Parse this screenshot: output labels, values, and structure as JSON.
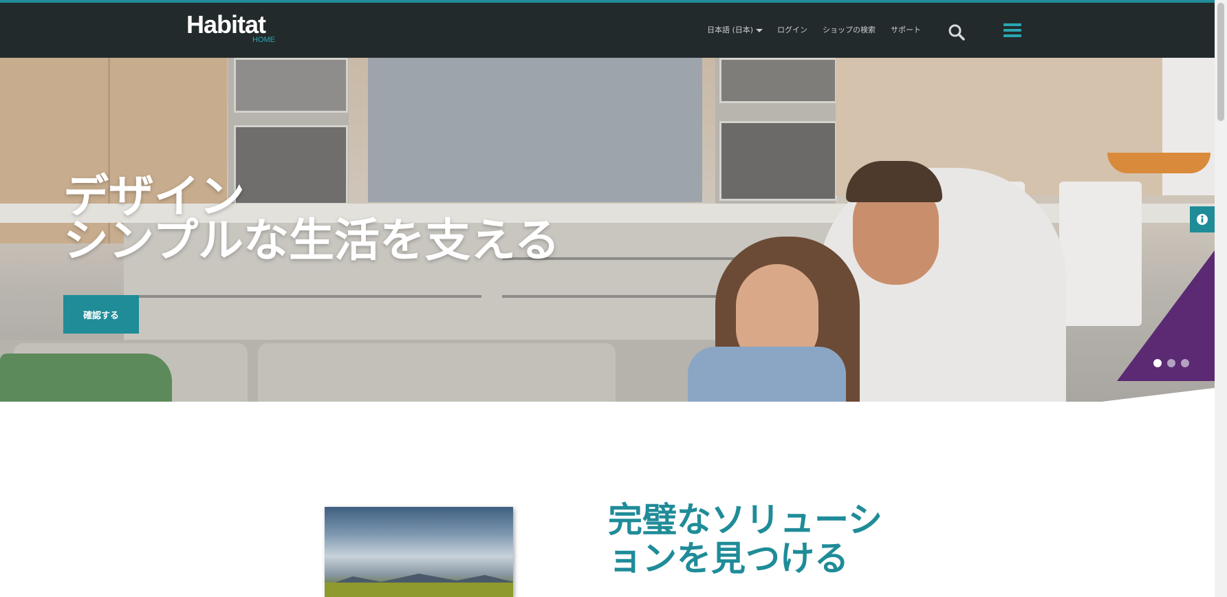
{
  "header": {
    "logo": {
      "main": "Habitat",
      "sub": "HOME"
    },
    "language_label": "日本語 (日本)",
    "nav": [
      {
        "id": "login",
        "label": "ログイン"
      },
      {
        "id": "store_locator",
        "label": "ショップの検索"
      },
      {
        "id": "support",
        "label": "サポート"
      }
    ],
    "icons": {
      "search": "search-icon",
      "menu": "menu-icon"
    }
  },
  "hero": {
    "title_line1": "デザイン",
    "title_line2": "シンプルな生活を支える",
    "cta_label": "確認する",
    "slides": {
      "count": 3,
      "active_index": 0
    },
    "info_icon": "info-icon"
  },
  "feature": {
    "title": "完璧なソリューションを見つける"
  },
  "colors": {
    "accent": "#1f8c98",
    "header_bg": "#232a2b",
    "purple": "#5b2a73"
  }
}
